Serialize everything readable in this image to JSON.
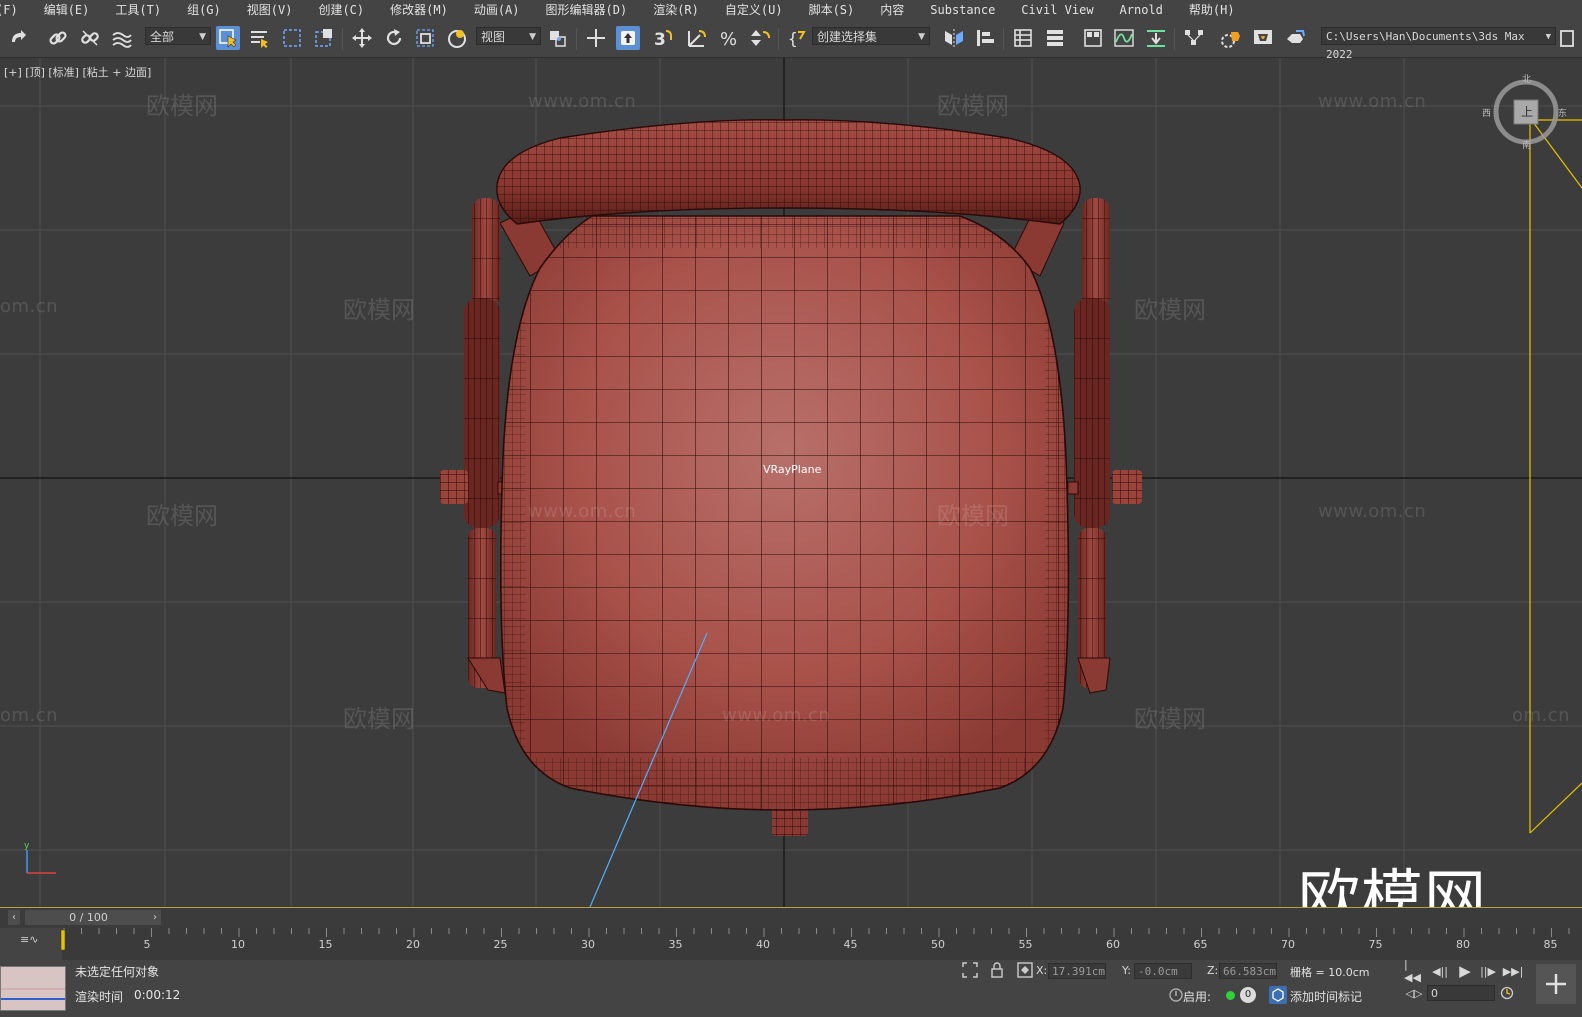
{
  "menu": {
    "items": [
      "(F)",
      "编辑(E)",
      "工具(T)",
      "组(G)",
      "视图(V)",
      "创建(C)",
      "修改器(M)",
      "动画(A)",
      "图形编辑器(D)",
      "渲染(R)",
      "自定义(U)",
      "脚本(S)",
      "内容",
      "Substance",
      "Civil View",
      "Arnold",
      "帮助(H)"
    ]
  },
  "toolbar": {
    "selection_filter": "全部",
    "coord_system": "视图",
    "named_selection": "创建选择集",
    "project_path": "C:\\Users\\Han\\Documents\\3ds Max 2022"
  },
  "viewport": {
    "label": "[+] [顶] [标准] [粘土 + 边面]",
    "object_label": "VRayPlane",
    "viewcube_face": "上",
    "compass": {
      "n": "北",
      "s": "南",
      "e": "东",
      "w": "西"
    },
    "watermarks": {
      "cn": "欧模网",
      "url": "www.om.cn",
      "url_partial": "om.cn",
      "big": "欧模网"
    }
  },
  "timeline": {
    "slider": "0 / 100",
    "ticks": [
      "5",
      "10",
      "15",
      "20",
      "25",
      "30",
      "35",
      "40",
      "45",
      "50",
      "55",
      "60",
      "65",
      "70",
      "75",
      "80",
      "85"
    ]
  },
  "status": {
    "message": "未选定任何对象",
    "render_time_label": "渲染时间",
    "render_time": "0:00:12",
    "x_label": "X:",
    "x_value": "17.391cm",
    "y_label": "Y:",
    "y_value": "-0.0cm",
    "z_label": "Z:",
    "z_value": "66.583cm",
    "grid": "栅格 = 10.0cm",
    "enable_label": "启用:",
    "enable_count": "0",
    "add_time_tag": "添加时间标记",
    "frame_value": "0"
  },
  "colors": {
    "background": "#444444",
    "viewport": "#3c3c3c",
    "chair_fill": "#a8524a",
    "wire": "#2a0a08",
    "accent": "#5b8fd6",
    "highlight_yellow": "#e8c400"
  }
}
